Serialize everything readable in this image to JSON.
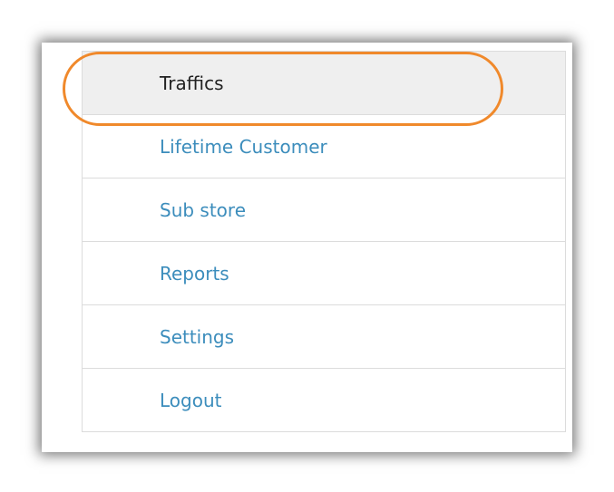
{
  "menu": {
    "items": [
      {
        "label": "Traffics",
        "active": true
      },
      {
        "label": "Lifetime Customer",
        "active": false
      },
      {
        "label": "Sub store",
        "active": false
      },
      {
        "label": "Reports",
        "active": false
      },
      {
        "label": "Settings",
        "active": false
      },
      {
        "label": "Logout",
        "active": false
      }
    ]
  },
  "colors": {
    "link": "#3c8dbc",
    "active_background": "#efefef",
    "highlight": "#f0892b"
  }
}
